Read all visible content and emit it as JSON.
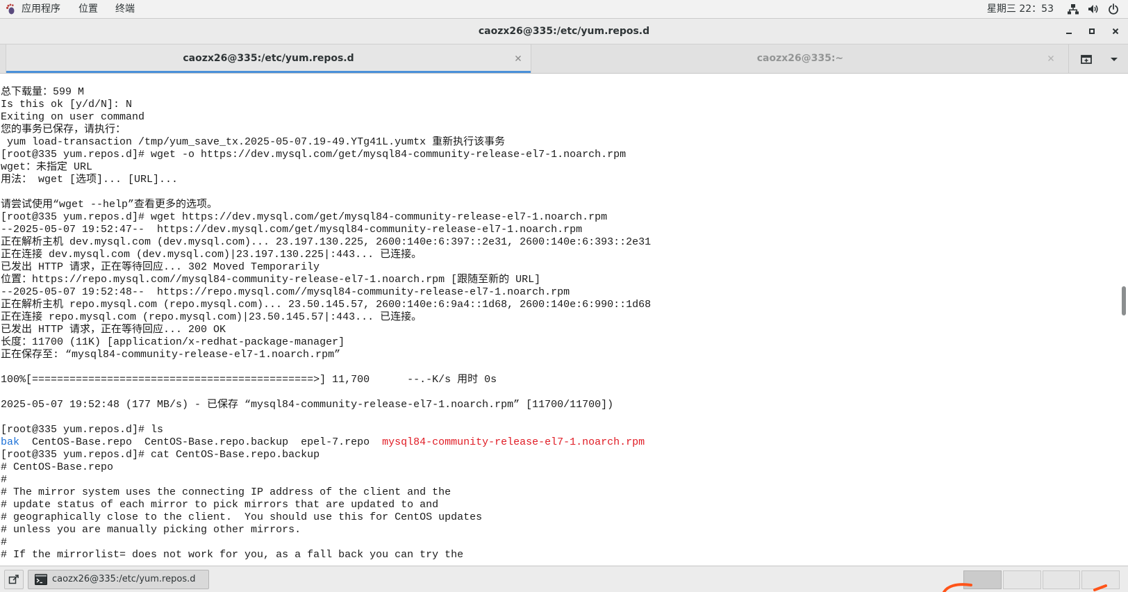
{
  "top_panel": {
    "applications_menu": "应用程序",
    "places_menu": "位置",
    "terminal_menu": "终端",
    "clock": "星期三 22：53",
    "icons": [
      "applications-icon",
      "network-icon",
      "volume-icon",
      "power-icon"
    ]
  },
  "window": {
    "title": "caozx26@335:/etc/yum.repos.d",
    "controls": [
      "minimize-icon",
      "maximize-icon",
      "close-icon"
    ]
  },
  "tabs": [
    {
      "label": "caozx26@335:/etc/yum.repos.d",
      "active": true
    },
    {
      "label": "caozx26@335:~",
      "active": false
    }
  ],
  "tab_bar_icons": [
    "new-tab-icon",
    "chevron-down-icon"
  ],
  "terminal": {
    "lines": [
      "总下载量：599 M",
      "Is this ok [y/d/N]: N",
      "Exiting on user command",
      "您的事务已保存，请执行：",
      " yum load-transaction /tmp/yum_save_tx.2025-05-07.19-49.YTg41L.yumtx 重新执行该事务",
      "[root@335 yum.repos.d]# wget -o https://dev.mysql.com/get/mysql84-community-release-el7-1.noarch.rpm",
      "wget：未指定 URL",
      "用法： wget [选项]... [URL]...",
      "",
      "请尝试使用“wget --help”查看更多的选项。",
      "[root@335 yum.repos.d]# wget https://dev.mysql.com/get/mysql84-community-release-el7-1.noarch.rpm",
      "--2025-05-07 19:52:47--  https://dev.mysql.com/get/mysql84-community-release-el7-1.noarch.rpm",
      "正在解析主机 dev.mysql.com (dev.mysql.com)... 23.197.130.225, 2600:140e:6:397::2e31, 2600:140e:6:393::2e31",
      "正在连接 dev.mysql.com (dev.mysql.com)|23.197.130.225|:443... 已连接。",
      "已发出 HTTP 请求，正在等待回应... 302 Moved Temporarily",
      "位置：https://repo.mysql.com//mysql84-community-release-el7-1.noarch.rpm [跟随至新的 URL]",
      "--2025-05-07 19:52:48--  https://repo.mysql.com//mysql84-community-release-el7-1.noarch.rpm",
      "正在解析主机 repo.mysql.com (repo.mysql.com)... 23.50.145.57, 2600:140e:6:9a4::1d68, 2600:140e:6:990::1d68",
      "正在连接 repo.mysql.com (repo.mysql.com)|23.50.145.57|:443... 已连接。",
      "已发出 HTTP 请求，正在等待回应... 200 OK",
      "长度：11700 (11K) [application/x-redhat-package-manager]",
      "正在保存至: “mysql84-community-release-el7-1.noarch.rpm”",
      "",
      "100%[=============================================>] 11,700      --.-K/s 用时 0s",
      "",
      "2025-05-07 19:52:48 (177 MB/s) - 已保存 “mysql84-community-release-el7-1.noarch.rpm” [11700/11700])",
      "",
      "[root@335 yum.repos.d]# ls",
      {
        "segments": [
          {
            "text": "bak",
            "color": "#1c71d8"
          },
          {
            "text": "  CentOS-Base.repo  CentOS-Base.repo.backup  epel-7.repo  "
          },
          {
            "text": "mysql84-community-release-el7-1.noarch.rpm",
            "color": "#e01b24"
          }
        ]
      },
      "[root@335 yum.repos.d]# cat CentOS-Base.repo.backup",
      "# CentOS-Base.repo",
      "#",
      "# The mirror system uses the connecting IP address of the client and the",
      "# update status of each mirror to pick mirrors that are updated to and",
      "# geographically close to the client.  You should use this for CentOS updates",
      "# unless you are manually picking other mirrors.",
      "#",
      "# If the mirrorlist= does not work for you, as a fall back you can try the"
    ],
    "scrollbar": {
      "position": 0.46
    }
  },
  "taskbar": {
    "show_desktop_icon": "show-desktop-icon",
    "window_button": {
      "icon": "terminal-icon",
      "label": "caozx26@335:/etc/yum.repos.d"
    },
    "workspaces": {
      "count": 4,
      "active": 1
    }
  },
  "colors": {
    "accent": "#4a90d9",
    "terminal_foreground": "#1a1a1a",
    "terminal_background": "#ffffff",
    "ls_directory": "#1c71d8",
    "ls_archive": "#e01b24",
    "annotation": "#ff5419"
  }
}
